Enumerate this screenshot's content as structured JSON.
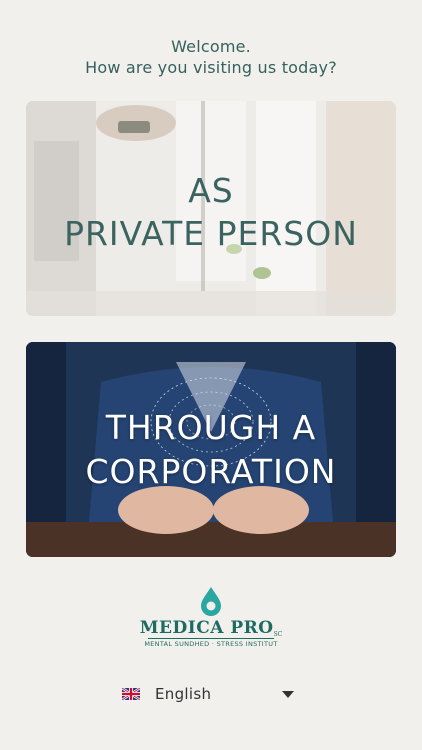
{
  "welcome": {
    "line1": "Welcome.",
    "line2": "How are you visiting us today?"
  },
  "cards": {
    "private": {
      "line1": "AS",
      "line2": "PRIVATE PERSON"
    },
    "corporation": {
      "line1": "THROUGH A",
      "line2": "CORPORATION"
    }
  },
  "logo": {
    "name": "MEDICA PRO",
    "superscript": "SC",
    "tagline": "MENTAL SUNDHED · STRESS INSTITUT"
  },
  "language": {
    "selected": "English",
    "flag_icon": "uk-flag-icon"
  },
  "colors": {
    "background": "#f2f0ed",
    "accent": "#36615d",
    "brand": "#1f6b64"
  }
}
